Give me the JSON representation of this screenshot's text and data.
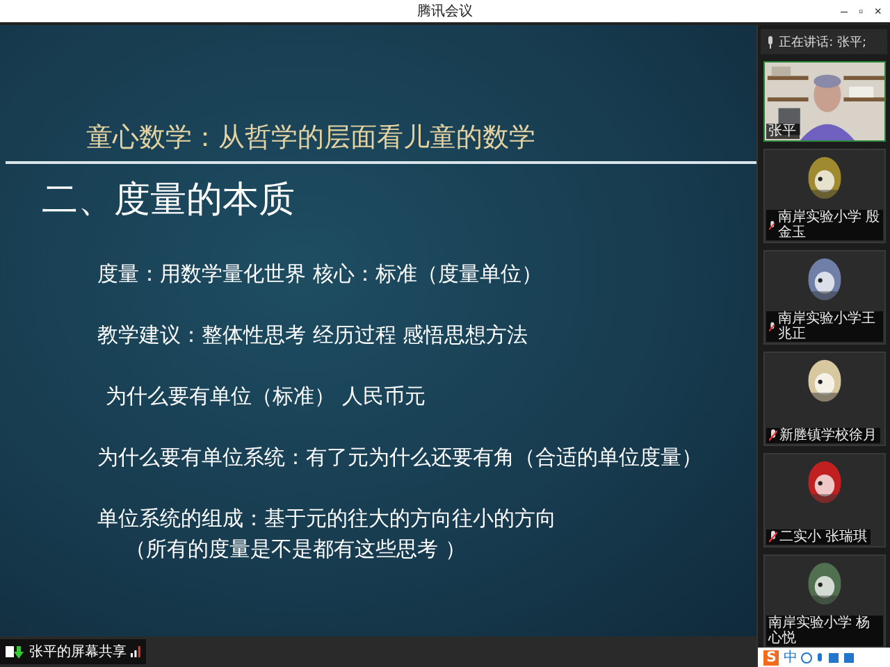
{
  "window": {
    "title": "腾讯会议",
    "controls": [
      "–",
      "▫",
      "×"
    ]
  },
  "slide": {
    "title": "童心数学：从哲学的层面看儿童的数学",
    "heading": "二、度量的本质",
    "lines": [
      {
        "text": "度量：用数学量化世界  核心：标准（度量单位）",
        "indent": false
      },
      {
        "text": "教学建议：整体性思考  经历过程   感悟思想方法",
        "indent": false
      },
      {
        "text": "为什么要有单位（标准）   人民币元",
        "indent": false
      },
      {
        "text": "为什么要有单位系统：有了元为什么还要有角（合适的单位度量）",
        "indent": false
      },
      {
        "text": "单位系统的组成：基于元的往大的方向往小的方向",
        "indent": false
      },
      {
        "text": "（所有的度量是不是都有这些思考 ）",
        "indent": true
      }
    ]
  },
  "share_label": "张平的屏幕共享",
  "speaking": {
    "label": "正在讲话: 张平;"
  },
  "participants": [
    {
      "name": "张平",
      "kind": "video",
      "muted": false
    },
    {
      "name": "南岸实验小学 殷金玉",
      "kind": "avatar",
      "muted": true
    },
    {
      "name": "南岸实验小学王兆正",
      "kind": "avatar",
      "muted": true
    },
    {
      "name": "新塍镇学校徐月",
      "kind": "avatar",
      "muted": true
    },
    {
      "name": "二实小 张瑞琪",
      "kind": "avatar",
      "muted": true
    },
    {
      "name": "南岸实验小学 杨心悦",
      "kind": "avatar",
      "muted": false
    }
  ],
  "ime": {
    "logo": "S",
    "mode": "中"
  }
}
